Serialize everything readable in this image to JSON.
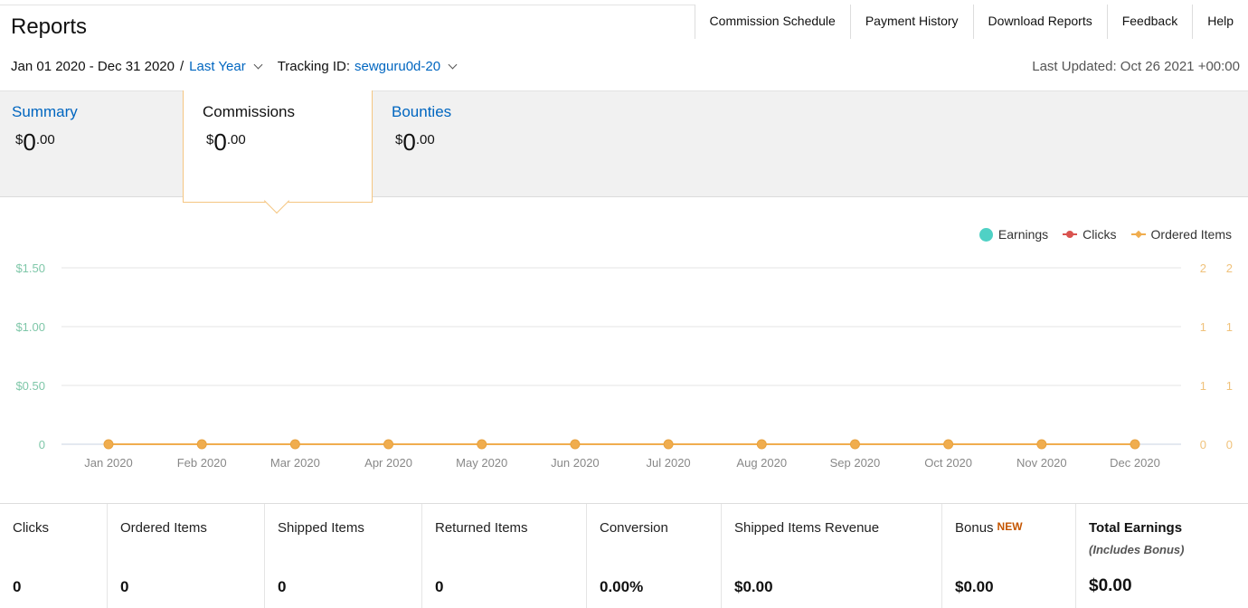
{
  "page": {
    "title": "Reports"
  },
  "nav": [
    {
      "label": "Commission Schedule"
    },
    {
      "label": "Payment History"
    },
    {
      "label": "Download Reports"
    },
    {
      "label": "Feedback"
    },
    {
      "label": "Help"
    }
  ],
  "filters": {
    "date_range": "Jan 01 2020 - Dec 31 2020",
    "separator": "/",
    "period": "Last Year",
    "tracking_label": "Tracking ID:",
    "tracking_id": "sewguru0d-20",
    "last_updated": "Last Updated: Oct 26 2021 +00:00"
  },
  "summary_tabs": [
    {
      "label": "Summary",
      "currency": "$",
      "whole": "0",
      "decimals": ".00",
      "active": false
    },
    {
      "label": "Commissions",
      "currency": "$",
      "whole": "0",
      "decimals": ".00",
      "active": true
    },
    {
      "label": "Bounties",
      "currency": "$",
      "whole": "0",
      "decimals": ".00",
      "active": false
    }
  ],
  "colors": {
    "earnings": "#4fd1c5",
    "clicks": "#d9534f",
    "ordered": "#f0ad4e",
    "earnings_axis": "#7fc7a9",
    "right_axis": "#f0c27b",
    "link": "#0066c0",
    "new_badge": "#c45500"
  },
  "chart_data": {
    "type": "line",
    "categories": [
      "Jan 2020",
      "Feb 2020",
      "Mar 2020",
      "Apr 2020",
      "May 2020",
      "Jun 2020",
      "Jul 2020",
      "Aug 2020",
      "Sep 2020",
      "Oct 2020",
      "Nov 2020",
      "Dec 2020"
    ],
    "series": [
      {
        "name": "Earnings",
        "values": [
          0,
          0,
          0,
          0,
          0,
          0,
          0,
          0,
          0,
          0,
          0,
          0
        ]
      },
      {
        "name": "Clicks",
        "values": [
          0,
          0,
          0,
          0,
          0,
          0,
          0,
          0,
          0,
          0,
          0,
          0
        ]
      },
      {
        "name": "Ordered Items",
        "values": [
          0,
          0,
          0,
          0,
          0,
          0,
          0,
          0,
          0,
          0,
          0,
          0
        ]
      }
    ],
    "y_left_ticks": [
      "0",
      "$0.50",
      "$1.00",
      "$1.50"
    ],
    "y_right_ticks_1": [
      "0",
      "1",
      "1",
      "2"
    ],
    "y_right_ticks_2": [
      "0",
      "1",
      "1",
      "2"
    ],
    "ylim": [
      0,
      1.5
    ],
    "grid": true,
    "legend": "top-right"
  },
  "stats": [
    {
      "label": "Clicks",
      "value": "0"
    },
    {
      "label": "Ordered Items",
      "value": "0"
    },
    {
      "label": "Shipped Items",
      "value": "0"
    },
    {
      "label": "Returned Items",
      "value": "0"
    },
    {
      "label": "Conversion",
      "value": "0.00%"
    },
    {
      "label": "Shipped Items Revenue",
      "value": "$0.00"
    },
    {
      "label": "Bonus",
      "badge": "NEW",
      "value": "$0.00"
    },
    {
      "label": "Total Earnings",
      "sub": "(Includes Bonus)",
      "value": "$0.00"
    }
  ]
}
